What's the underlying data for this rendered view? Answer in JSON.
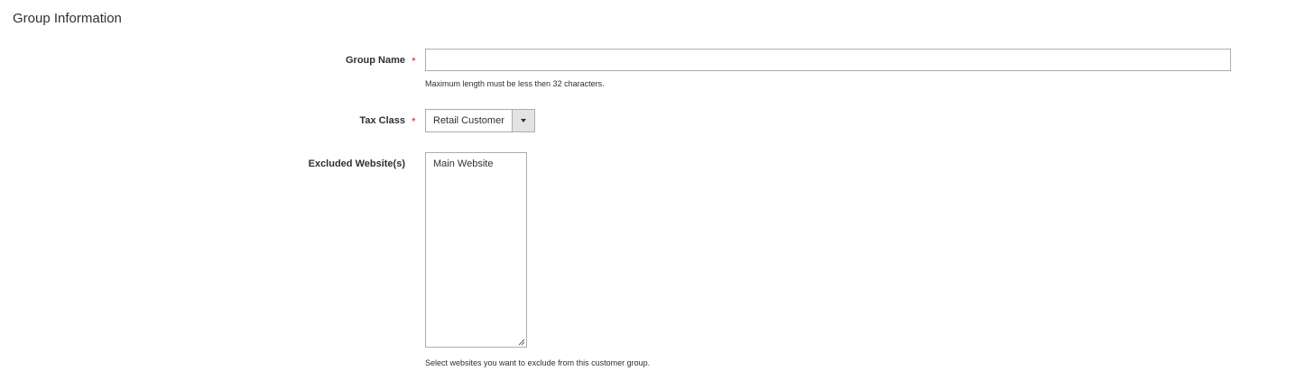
{
  "section": {
    "title": "Group Information"
  },
  "fields": {
    "group_name": {
      "label": "Group Name",
      "required_marker": "*",
      "value": "",
      "placeholder": "",
      "note": "Maximum length must be less then 32 characters."
    },
    "tax_class": {
      "label": "Tax Class",
      "required_marker": "*",
      "selected": "Retail Customer"
    },
    "excluded_websites": {
      "label": "Excluded Website(s)",
      "options": [
        "Main Website"
      ],
      "note": "Select websites you want to exclude from this customer group."
    }
  },
  "icons": {
    "select_arrow": "chevron-down-icon",
    "resize": "resize-grip-icon"
  },
  "colors": {
    "required": "#e22626",
    "border": "#adadad",
    "select_button_bg": "#e3e3e3",
    "text": "#303030"
  }
}
